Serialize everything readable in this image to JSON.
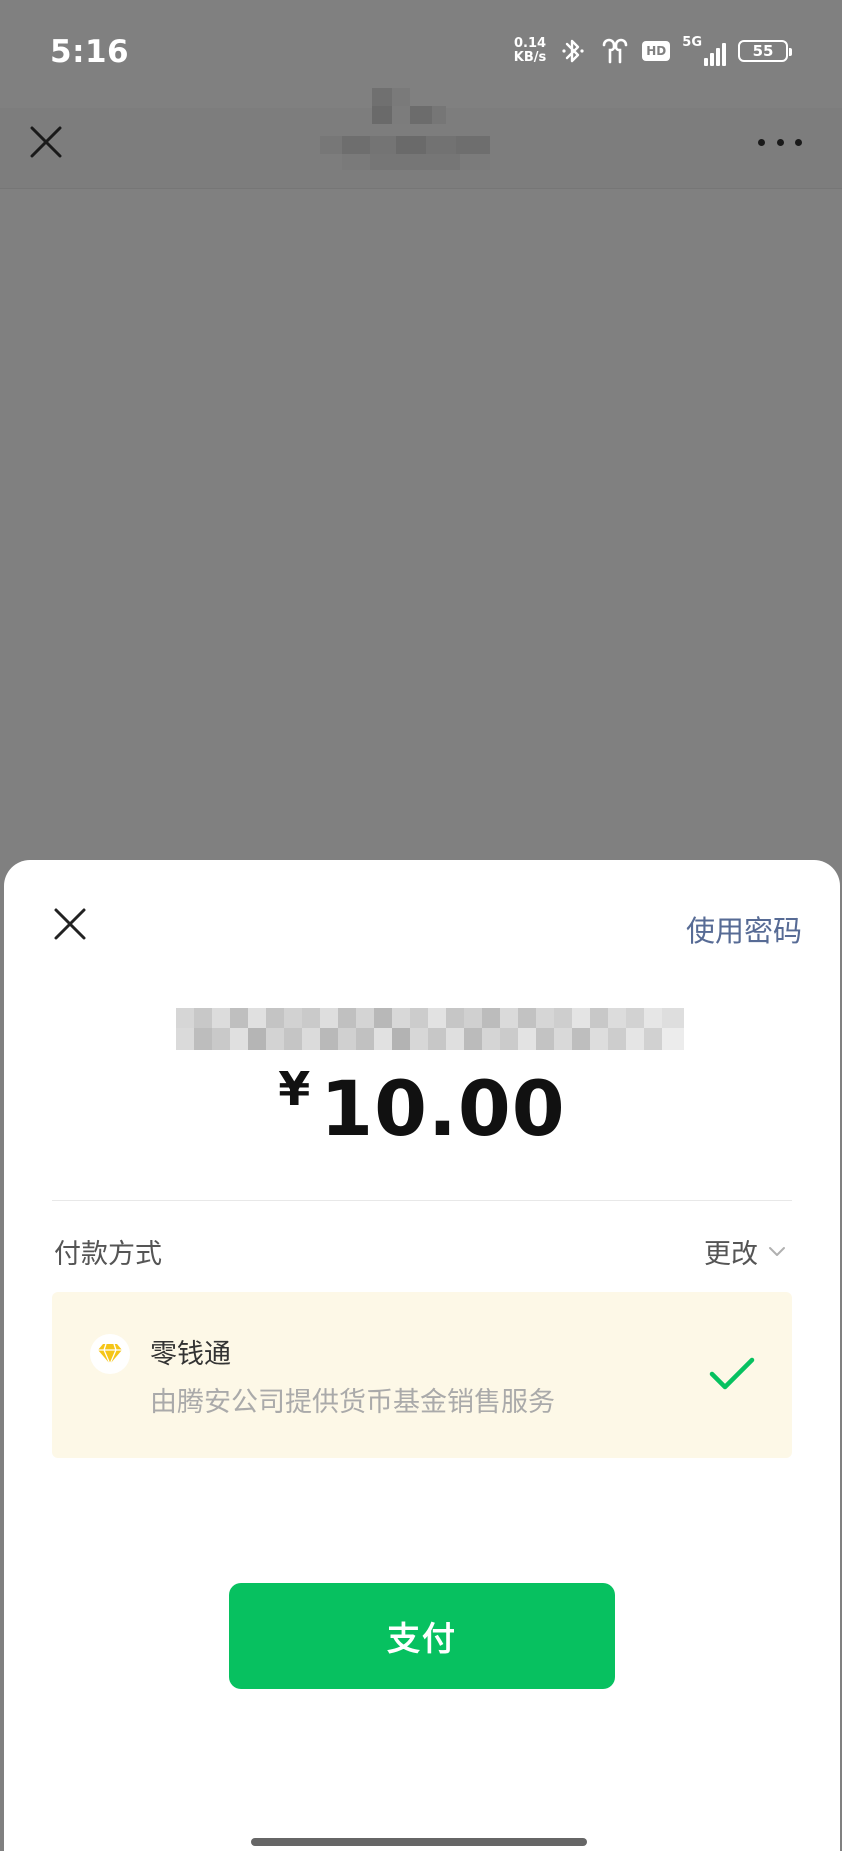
{
  "status_bar": {
    "time": "5:16",
    "net_speed_value": "0.14",
    "net_speed_unit": "KB/s",
    "hd_label": "HD",
    "network_label": "5G",
    "battery_level": "55"
  },
  "top_nav": {
    "close_icon": "close-icon",
    "more_icon": "more-icon"
  },
  "sheet": {
    "use_password_label": "使用密码",
    "currency_symbol": "¥",
    "amount": "10.00",
    "pay_method_label": "付款方式",
    "change_label": "更改",
    "method": {
      "name": "零钱通",
      "description": "由腾安公司提供货币基金销售服务",
      "icon": "diamond-icon",
      "selected": true
    },
    "pay_button_label": "支付"
  },
  "colors": {
    "accent_green": "#07c160",
    "link_blue": "#576b95",
    "card_bg": "#fdf8e7",
    "overlay": "#808080"
  }
}
